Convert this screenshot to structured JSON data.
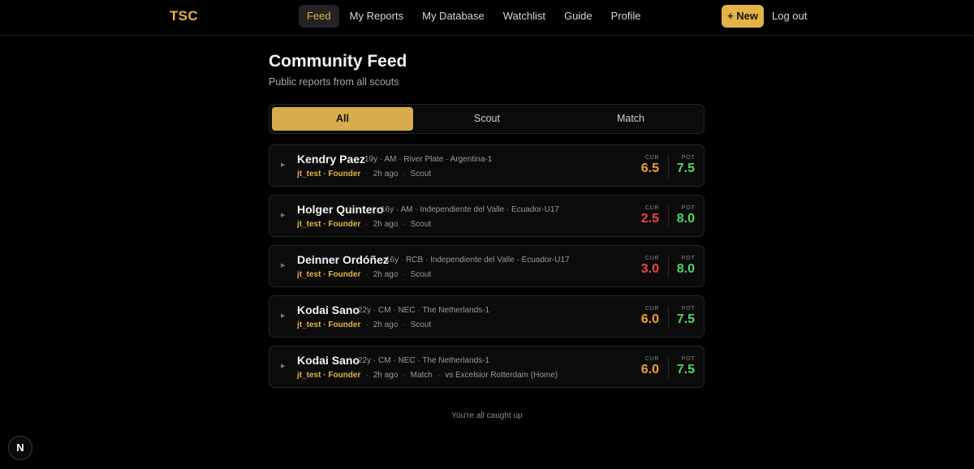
{
  "brand": {
    "logo": "TSC"
  },
  "nav": [
    {
      "label": "Feed",
      "active": true
    },
    {
      "label": "My Reports",
      "active": false
    },
    {
      "label": "My Database",
      "active": false
    },
    {
      "label": "Watchlist",
      "active": false
    },
    {
      "label": "Guide",
      "active": false
    },
    {
      "label": "Profile",
      "active": false
    }
  ],
  "actions": {
    "new_label": "+ New",
    "logout_label": "Log out"
  },
  "header": {
    "title": "Community Feed",
    "subtitle": "Public reports from all scouts"
  },
  "tabs": [
    {
      "label": "All",
      "active": true
    },
    {
      "label": "Scout",
      "active": false
    },
    {
      "label": "Match",
      "active": false
    }
  ],
  "score_labels": {
    "cur": "CUR",
    "pot": "POT"
  },
  "colors": {
    "accent": "#e2b447",
    "green": "#4fd46b",
    "orange": "#f0a030",
    "red": "#ef4444"
  },
  "reports": [
    {
      "name": "Kendry Paez",
      "meta": "19y · AM · River Plate · Argentina-1",
      "author": "jt_test · Founder",
      "time": "2h ago",
      "type": "Scout",
      "extra": "",
      "cur": "6.5",
      "pot": "7.5",
      "cur_color": "#f0a030",
      "pot_color": "#4fd46b"
    },
    {
      "name": "Holger Quintero",
      "meta": "16y · AM · Independiente del Valle · Ecuador-U17",
      "author": "jt_test · Founder",
      "time": "2h ago",
      "type": "Scout",
      "extra": "",
      "cur": "2.5",
      "pot": "8.0",
      "cur_color": "#ef4444",
      "pot_color": "#4fd46b"
    },
    {
      "name": "Deinner Ordóñez",
      "meta": "16y · RCB · Independiente del Valle · Ecuador-U17",
      "author": "jt_test · Founder",
      "time": "2h ago",
      "type": "Scout",
      "extra": "",
      "cur": "3.0",
      "pot": "8.0",
      "cur_color": "#ef4444",
      "pot_color": "#4fd46b"
    },
    {
      "name": "Kodai Sano",
      "meta": "22y · CM · NEC · The Netherlands-1",
      "author": "jt_test · Founder",
      "time": "2h ago",
      "type": "Scout",
      "extra": "",
      "cur": "6.0",
      "pot": "7.5",
      "cur_color": "#f0a030",
      "pot_color": "#4fd46b"
    },
    {
      "name": "Kodai Sano",
      "meta": "22y · CM · NEC · The Netherlands-1",
      "author": "jt_test · Founder",
      "time": "2h ago",
      "type": "Match",
      "extra": "vs Excelsior Rotterdam (Home)",
      "cur": "6.0",
      "pot": "7.5",
      "cur_color": "#f0a030",
      "pot_color": "#4fd46b"
    }
  ],
  "footer": {
    "text": "You're all caught up"
  },
  "badge": {
    "letter": "N"
  }
}
